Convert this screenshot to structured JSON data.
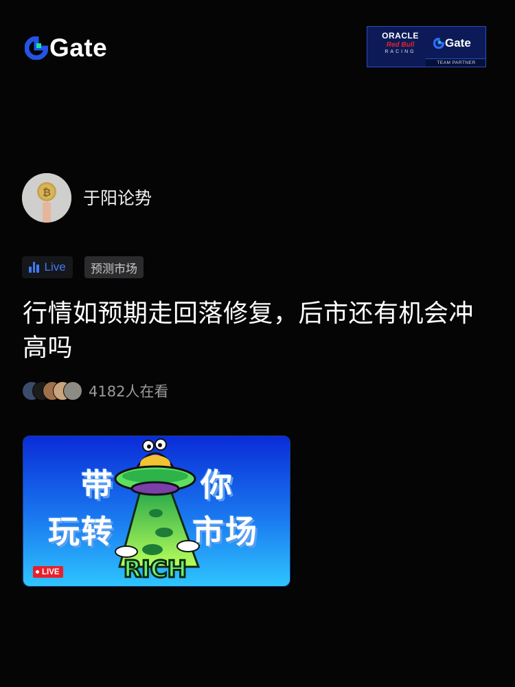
{
  "header": {
    "logo_text": "Gate",
    "partner_badge": {
      "line1": "ORACLE",
      "line2": "Red Bull",
      "line3": "RACING",
      "brand": "Gate",
      "caption": "TEAM PARTNER"
    }
  },
  "author": {
    "name": "于阳论势",
    "avatar_icon": "bitcoin-coin-avatar"
  },
  "tags": {
    "live_label": "Live",
    "topic": "预测市场"
  },
  "post": {
    "title": "行情如预期走回落修复，后市还有机会冲高吗"
  },
  "viewers": {
    "count_text": "4182人在看"
  },
  "thumbnail": {
    "line1_left": "带",
    "line1_right": "你",
    "line2_left": "玩转",
    "line2_right": "市场",
    "ufo_text": "RICH",
    "live_badge": "LIVE"
  },
  "colors": {
    "background": "#050505",
    "accent_blue": "#3d7bf7",
    "live_red": "#e8202b",
    "brand_green": "#17e6a1",
    "brand_blue": "#2354e6"
  }
}
